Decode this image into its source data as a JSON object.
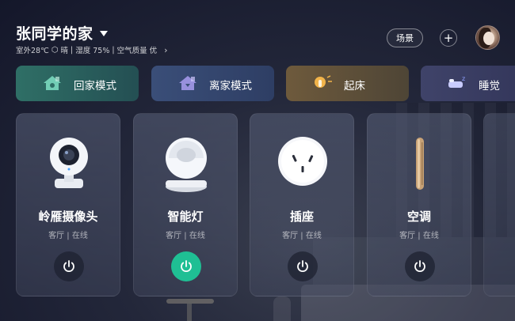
{
  "header": {
    "home_title": "张同学的家",
    "weather": {
      "outdoor_temp": "室外28℃",
      "condition": "晴",
      "humidity": "湿度 75%",
      "air_quality": "空气质量 优",
      "separator": "|"
    },
    "scene_button": "场景",
    "add_button": "+"
  },
  "modes": [
    {
      "label": "回家模式",
      "icon": "home-mode-icon",
      "color": "#2f6f66"
    },
    {
      "label": "离家模式",
      "icon": "leave-home-icon",
      "color": "#3a4e78"
    },
    {
      "label": "起床",
      "icon": "wake-up-icon",
      "color": "#6e5a3c"
    },
    {
      "label": "睡觉",
      "icon": "sleep-icon",
      "color": "#3f4369"
    }
  ],
  "devices": [
    {
      "name": "岭雁摄像头",
      "status": "客厅 | 在线",
      "icon": "camera-icon",
      "power_on": false
    },
    {
      "name": "智能灯",
      "status": "客厅 | 在线",
      "icon": "smart-lamp-icon",
      "power_on": true
    },
    {
      "name": "插座",
      "status": "客厅 | 在线",
      "icon": "socket-icon",
      "power_on": false
    },
    {
      "name": "空调",
      "status": "客厅 | 在线",
      "icon": "air-conditioner-icon",
      "power_on": false
    }
  ],
  "colors": {
    "power_on": "#1fbf94",
    "power_off": "#1e2230"
  }
}
